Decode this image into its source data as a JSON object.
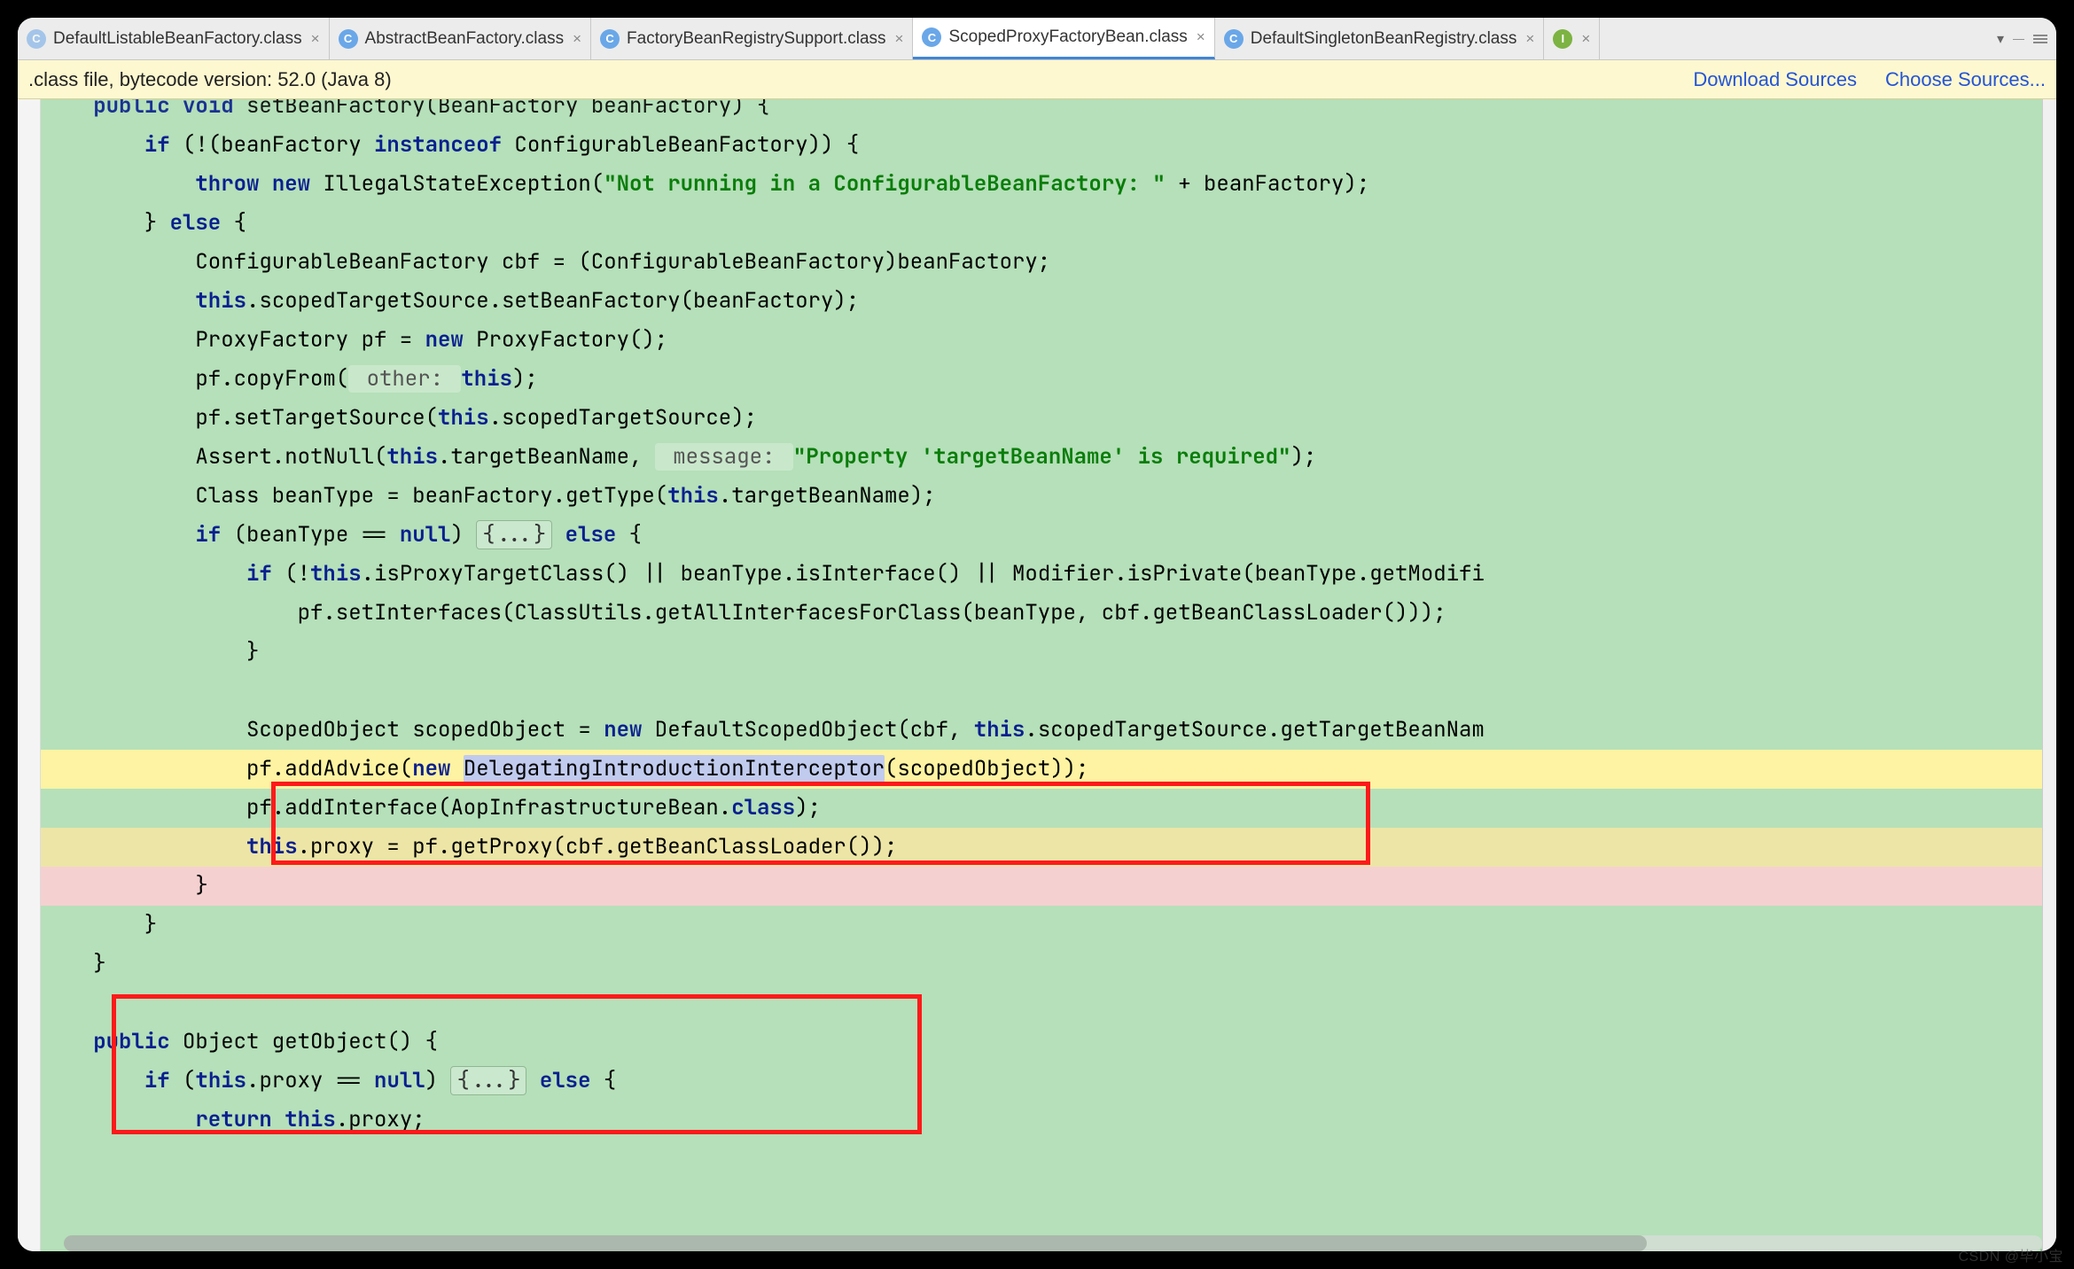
{
  "tabs": [
    {
      "label": "DefaultListableBeanFactory.class",
      "icon": "C",
      "iconClass": "icon-c faded",
      "active": false
    },
    {
      "label": "AbstractBeanFactory.class",
      "icon": "C",
      "iconClass": "icon-c",
      "active": false
    },
    {
      "label": "FactoryBeanRegistrySupport.class",
      "icon": "C",
      "iconClass": "icon-c",
      "active": false
    },
    {
      "label": "ScopedProxyFactoryBean.class",
      "icon": "C",
      "iconClass": "icon-c",
      "active": true
    },
    {
      "label": "DefaultSingletonBeanRegistry.class",
      "icon": "C",
      "iconClass": "icon-c",
      "active": false
    },
    {
      "label": "",
      "icon": "I",
      "iconClass": "icon-i",
      "active": false
    }
  ],
  "infobar": {
    "status": ".class file, bytecode version: 52.0 (Java 8)",
    "download": "Download Sources",
    "choose": "Choose Sources..."
  },
  "code": {
    "t_public": "public",
    "t_void": "void",
    "t_if": "if",
    "t_instanceof": "instanceof",
    "t_throw": "throw",
    "t_new": "new",
    "t_else": "else",
    "t_this": "this",
    "t_null": "null",
    "t_class": "class",
    "t_return": "return",
    "line0_a": " setBeanFactory(BeanFactory beanFactory) {",
    "line1_a": "    ",
    "line1_b": " (!(beanFactory ",
    "line1_c": " ConfigurableBeanFactory)) {",
    "line2_a": "        ",
    "line2_b": " IllegalStateException(",
    "str1": "\"Not running in a ConfigurableBeanFactory: \"",
    "line2_c": " + beanFactory);",
    "line3_a": "    } ",
    "line3_b": " {",
    "line4": "        ConfigurableBeanFactory cbf = (ConfigurableBeanFactory)beanFactory;",
    "line5_a": "        ",
    "line5_b": ".scopedTargetSource.setBeanFactory(beanFactory);",
    "line6_a": "        ProxyFactory pf = ",
    "line6_b": " ProxyFactory();",
    "line7_a": "        pf.copyFrom(",
    "hint_other": " other: ",
    "line7_b": ");",
    "line8_a": "        pf.setTargetSource(",
    "line8_b": ".scopedTargetSource);",
    "line9_a": "        Assert.notNull(",
    "line9_b": ".targetBeanName, ",
    "hint_message": " message: ",
    "str2": "\"Property 'targetBeanName' is required\"",
    "line9_c": ");",
    "line10_a": "        Class<?> beanType = beanFactory.getType(",
    "line10_b": ".targetBeanName);",
    "line11_a": "        ",
    "line11_b": " (beanType == ",
    "line11_c": ") ",
    "fold": "{...}",
    "line11_d": " {",
    "line12_a": "            ",
    "line12_b": " (!",
    "line12_c": ".isProxyTargetClass() || beanType.isInterface() || Modifier.isPrivate(beanType.getModifi",
    "line13": "                pf.setInterfaces(ClassUtils.getAllInterfacesForClass(beanType, cbf.getBeanClassLoader()));",
    "line14": "            }",
    "line15": "",
    "line16_a": "            ScopedObject scopedObject = ",
    "line16_b": " DefaultScopedObject(cbf, ",
    "line16_c": ".scopedTargetSource.getTargetBeanNam",
    "line17_a": "            pf.addAdvice(",
    "sel_text": "DelegatingIntroductionInterceptor",
    "line17_b": "(scopedObject));",
    "line18_a": "            pf.addInterface(AopInfrastructureBean.",
    "line18_b": ");",
    "line19_a": "            ",
    "line19_b": ".proxy = pf.getProxy(cbf.getBeanClassLoader());",
    "line20": "        }",
    "line21": "    }",
    "line22": "}",
    "line23": "",
    "line24_a": " Object getObject() {",
    "line25_a": "    ",
    "line25_b": " (",
    "line25_c": ".proxy == ",
    "line25_d": ") ",
    "line25_e": " {",
    "line26_a": "        ",
    "line26_b": ".proxy;"
  },
  "watermark": "CSDN @毕小宝"
}
